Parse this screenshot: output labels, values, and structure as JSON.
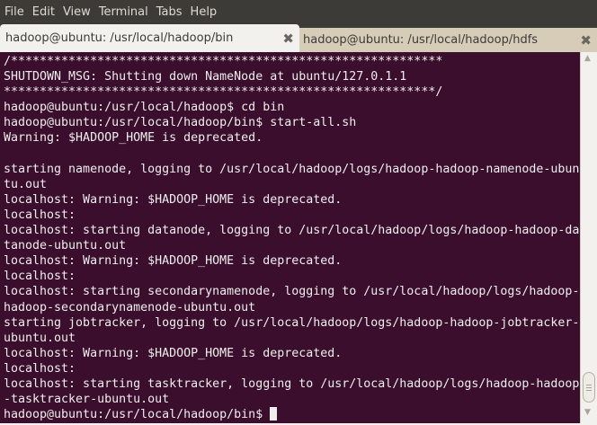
{
  "menu": [
    "File",
    "Edit",
    "View",
    "Terminal",
    "Tabs",
    "Help"
  ],
  "tabs": [
    {
      "label": "hadoop@ubuntu: /usr/local/hadoop/bin",
      "active": true
    },
    {
      "label": "hadoop@ubuntu: /usr/local/hadoop/hdfs",
      "active": false
    }
  ],
  "terminal": {
    "lines": [
      "/************************************************************",
      "SHUTDOWN_MSG: Shutting down NameNode at ubuntu/127.0.1.1",
      "************************************************************/",
      "hadoop@ubuntu:/usr/local/hadoop$ cd bin",
      "hadoop@ubuntu:/usr/local/hadoop/bin$ start-all.sh",
      "Warning: $HADOOP_HOME is deprecated.",
      "",
      "starting namenode, logging to /usr/local/hadoop/logs/hadoop-hadoop-namenode-ubun",
      "tu.out",
      "localhost: Warning: $HADOOP_HOME is deprecated.",
      "localhost:",
      "localhost: starting datanode, logging to /usr/local/hadoop/logs/hadoop-hadoop-da",
      "tanode-ubuntu.out",
      "localhost: Warning: $HADOOP_HOME is deprecated.",
      "localhost:",
      "localhost: starting secondarynamenode, logging to /usr/local/hadoop/logs/hadoop-",
      "hadoop-secondarynamenode-ubuntu.out",
      "starting jobtracker, logging to /usr/local/hadoop/logs/hadoop-hadoop-jobtracker-",
      "ubuntu.out",
      "localhost: Warning: $HADOOP_HOME is deprecated.",
      "localhost:",
      "localhost: starting tasktracker, logging to /usr/local/hadoop/logs/hadoop-hadoop",
      "-tasktracker-ubuntu.out"
    ],
    "prompt": "hadoop@ubuntu:/usr/local/hadoop/bin$ "
  }
}
